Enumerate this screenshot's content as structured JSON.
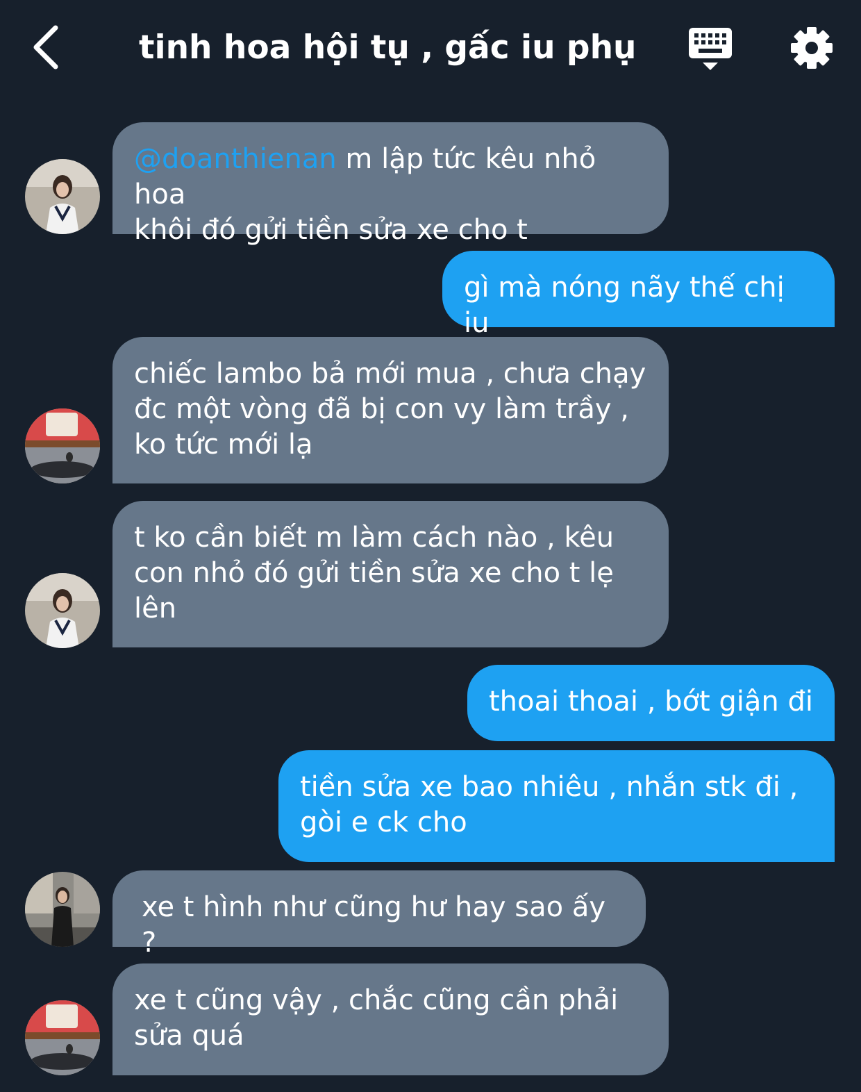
{
  "header": {
    "title": "tinh hoa hội tụ , gấc iu phụ...",
    "back_icon": "chevron-left-icon",
    "keyboard_icon": "keyboard-icon",
    "settings_icon": "gear-icon"
  },
  "colors": {
    "background": "#17202c",
    "incoming_bubble": "#66778a",
    "outgoing_bubble": "#1ea1f2",
    "mention": "#1ea1f2"
  },
  "messages": [
    {
      "direction": "incoming",
      "mention": "@doanthienan",
      "text": " m lập tức kêu nhỏ hoa\nkhôi đó gửi tiền sửa xe cho t"
    },
    {
      "direction": "outgoing",
      "text": "gì mà nóng nãy thế chị iu"
    },
    {
      "direction": "incoming",
      "text": "chiếc lambo bả mới mua , chưa chạy\nđc một vòng đã bị con vy làm trầy ,\nko tức mới lạ"
    },
    {
      "direction": "incoming",
      "text": "t ko cần biết m làm cách nào , kêu\ncon nhỏ đó gửi tiền sửa xe cho t lẹ\nlên"
    },
    {
      "direction": "outgoing",
      "text": "thoai thoai , bớt giận đi"
    },
    {
      "direction": "outgoing",
      "text": "tiền sửa xe bao nhiêu , nhắn stk đi ,\ngòi e ck cho"
    },
    {
      "direction": "incoming",
      "text": "xe t hình như cũng hư hay sao ấy ?"
    },
    {
      "direction": "incoming",
      "text": "xe t cũng vậy , chắc cũng cần phải\nsửa quá"
    }
  ]
}
